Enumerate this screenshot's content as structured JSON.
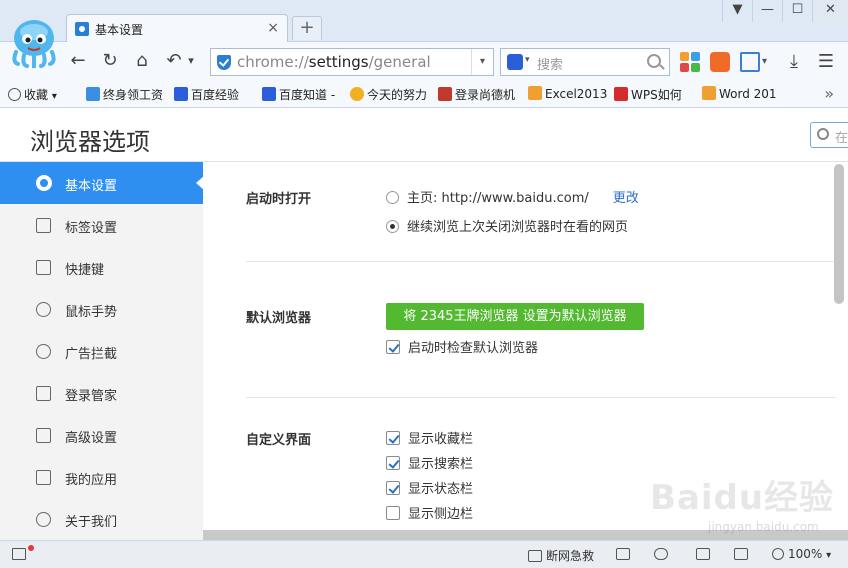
{
  "tab": {
    "title": "基本设置",
    "close": "×"
  },
  "newtab": "+",
  "window_buttons": [
    "▼",
    "—",
    "☐",
    "✕"
  ],
  "nav": {
    "back": "←",
    "refresh": "↻",
    "home": "⌂",
    "undo": "↶",
    "undo_drop": "▾"
  },
  "address": {
    "scheme": "chrome://",
    "host": "settings",
    "path": "/general",
    "drop": "▾"
  },
  "search": {
    "placeholder": "搜索",
    "dd": "▾"
  },
  "toolbar": {
    "menu": "☰",
    "download": "⤓",
    "device_drop": "▾"
  },
  "bookmarks": {
    "collect": "收藏",
    "collect_drop": "▾",
    "items": [
      "终身领工资",
      "百度经验",
      "百度知道 -",
      "今天的努力",
      "登录尚德机",
      "Excel2013",
      "WPS如何",
      "Word 201"
    ],
    "more": "»"
  },
  "page": {
    "title": "浏览器选项",
    "search_placeholder": "在"
  },
  "sidebar": {
    "items": [
      "基本设置",
      "标签设置",
      "快捷键",
      "鼠标手势",
      "广告拦截",
      "登录管家",
      "高级设置",
      "我的应用",
      "关于我们"
    ]
  },
  "sections": {
    "startup": {
      "title": "启动时打开",
      "homepage_label": "主页: http://www.baidu.com/",
      "change_link": "更改",
      "continue_label": "继续浏览上次关闭浏览器时在看的网页"
    },
    "default_browser": {
      "title": "默认浏览器",
      "button": "将 2345王牌浏览器 设置为默认浏览器",
      "check_label": "启动时检查默认浏览器"
    },
    "custom_ui": {
      "title": "自定义界面",
      "options": [
        "显示收藏栏",
        "显示搜索栏",
        "显示状态栏",
        "显示侧边栏"
      ]
    }
  },
  "statusbar": {
    "network": "断网急救",
    "zoom": "100%",
    "zoom_drop": "▾"
  },
  "watermark": {
    "logo": "Baidu经验",
    "url": "jingyan.baidu.com"
  },
  "colors": {
    "accent": "#2e8ff0",
    "green_button": "#52b930",
    "link": "#2a6fc9",
    "frame": "#dfe9f5"
  }
}
